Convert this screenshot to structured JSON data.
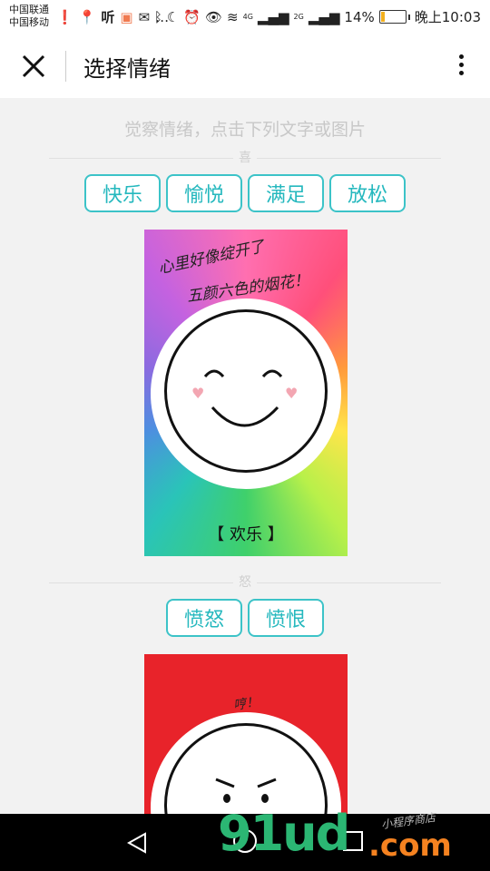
{
  "status_bar": {
    "carrier1": "中国联通",
    "carrier2": "中国移动",
    "network1": "4G",
    "network2": "2G",
    "battery": "14%",
    "battery_level": 0.14,
    "time": "晚上10:03"
  },
  "header": {
    "title": "选择情绪",
    "close_icon": "close-icon",
    "more_icon": "more-vertical-icon"
  },
  "main": {
    "hint": "觉察情绪，点击下列文字或图片",
    "groups": [
      {
        "label": "喜",
        "buttons": [
          "快乐",
          "愉悦",
          "满足",
          "放松"
        ],
        "card": {
          "line1": "心里好像绽开了",
          "line2": "五颜六色的烟花！",
          "caption": "【 欢乐 】"
        }
      },
      {
        "label": "怒",
        "buttons": [
          "愤怒",
          "愤恨"
        ],
        "card": {
          "line1": "哼！"
        }
      }
    ]
  },
  "watermark": {
    "main": "91ud",
    "domain": ".com",
    "sub": "小程序商店"
  },
  "colors": {
    "accent": "#25b8be",
    "angry_bg": "#e8232a",
    "battery_fill": "#f2b01e"
  }
}
